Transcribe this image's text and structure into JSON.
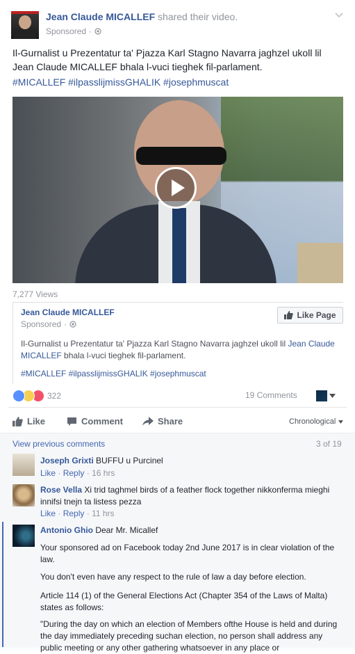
{
  "post": {
    "author": "Jean Claude MICALLEF",
    "action": "shared their video.",
    "sponsored": "Sponsored",
    "text": "Il-Gurnalist u Prezentatur ta' Pjazza Karl Stagno Navarra jaghzel ukoll lil Jean Claude MICALLEF bhala l-vuci tieghek fil-parlament.",
    "hashtags": "#MICALLEF #ilpasslijmissGHALIK #josephmuscat",
    "views": "7,277 Views"
  },
  "shared": {
    "author": "Jean Claude MICALLEF",
    "sponsored": "Sponsored",
    "like_page": "Like Page",
    "text_start": "Il-Gurnalist u Prezentatur ta' Pjazza Karl Stagno Navarra jaghzel ukoll lil ",
    "text_name": "Jean Claude MICALLEF",
    "text_end": " bhala l-vuci tieghek fil-parlament.",
    "hashtags": "#MICALLEF #ilpasslijmissGHALIK #josephmuscat"
  },
  "stats": {
    "reactions": "322",
    "comments": "19 Comments"
  },
  "actions": {
    "like": "Like",
    "comment": "Comment",
    "share": "Share",
    "sort": "Chronological"
  },
  "comments_header": {
    "view_previous": "View previous comments",
    "count": "3 of 19"
  },
  "comments": [
    {
      "author": "Joseph Grixti",
      "text": "BUFFU u Purcinel",
      "like": "Like",
      "reply": "Reply",
      "time": "16 hrs"
    },
    {
      "author": "Rose Vella",
      "text": "Xi trid taghmel birds of a feather flock together nikkonferma mieghi innifsi tnejn ta listess pezza",
      "like": "Like",
      "reply": "Reply",
      "time": "11 hrs"
    },
    {
      "author": "Antonio Ghio",
      "first": "Dear Mr. Micallef",
      "p1": "Your sponsored ad on Facebook today 2nd June 2017 is in clear violation of the law.",
      "p2": "You don't even have any respect to the rule of law a day before election.",
      "p3": "Article 114 (1) of the General Elections Act (Chapter 354 of the Laws of Malta) states as follows:",
      "p4": "\"During the day on which an election of Members ofthe House is held and during the day immediately preceding suchan election, no person shall address any public meeting or any other gathering whatsoever in any place or"
    }
  ],
  "colors": {
    "link": "#365899",
    "accent": "#4267b2",
    "muted": "#90949c"
  }
}
